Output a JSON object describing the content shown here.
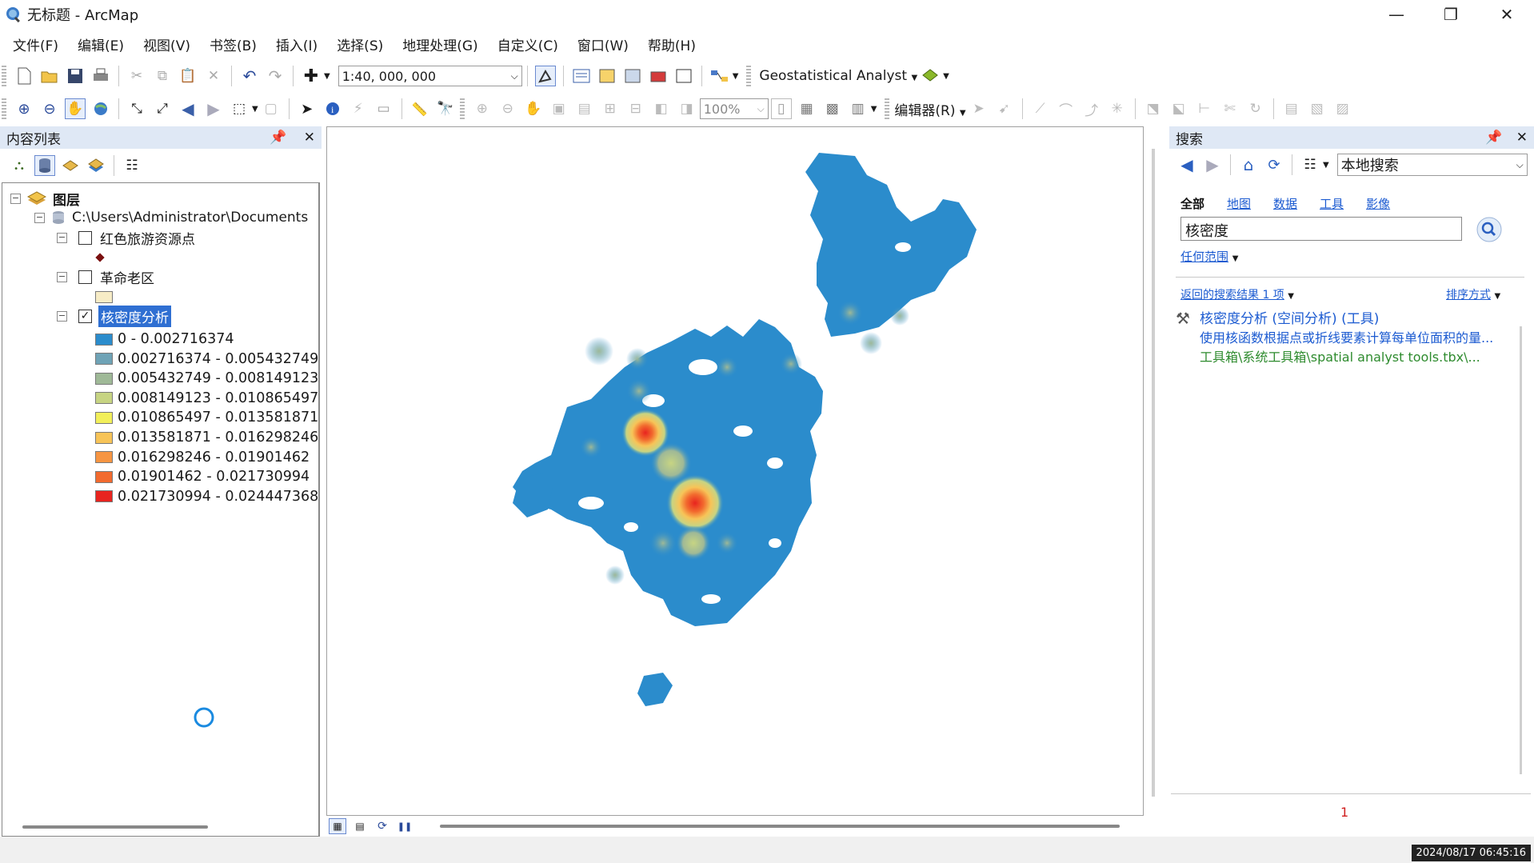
{
  "window": {
    "title": "无标题 - ArcMap"
  },
  "menu": [
    "文件(F)",
    "编辑(E)",
    "视图(V)",
    "书签(B)",
    "插入(I)",
    "选择(S)",
    "地理处理(G)",
    "自定义(C)",
    "窗口(W)",
    "帮助(H)"
  ],
  "toolbar": {
    "scale": "1:40, 000, 000",
    "geostat_label": "Geostatistical Analyst",
    "zoom_percent": "100%",
    "editor_label": "编辑器(R)"
  },
  "toc": {
    "title": "内容列表",
    "root_label": "图层",
    "datasource": "C:\\Users\\Administrator\\Documents",
    "layers": [
      {
        "name": "红色旅游资源点",
        "checked": false
      },
      {
        "name": "革命老区",
        "checked": false
      },
      {
        "name": "核密度分析",
        "checked": true
      }
    ],
    "legend": [
      {
        "label": "0 - 0.002716374",
        "color": "#2b8ccc"
      },
      {
        "label": "0.002716374 - 0.005432749",
        "color": "#6fa3b6"
      },
      {
        "label": "0.005432749 - 0.008149123",
        "color": "#9fb997"
      },
      {
        "label": "0.008149123 - 0.010865497",
        "color": "#c7d483"
      },
      {
        "label": "0.010865497 - 0.013581871",
        "color": "#f2ef5a"
      },
      {
        "label": "0.013581871 - 0.016298246",
        "color": "#f7c458"
      },
      {
        "label": "0.016298246 - 0.01901462",
        "color": "#f79542"
      },
      {
        "label": "0.01901462 - 0.021730994",
        "color": "#f26a2e"
      },
      {
        "label": "0.021730994 - 0.024447368",
        "color": "#e8241f"
      }
    ],
    "point_symbol_color": "#7a1010",
    "polygon_symbol_color": "#f7ecc6"
  },
  "search": {
    "title": "搜索",
    "scope_combo": "本地搜索",
    "tabs": [
      "全部",
      "地图",
      "数据",
      "工具",
      "影像"
    ],
    "query": "核密度",
    "any_extent": "任何范围",
    "results_count": "返回的搜索结果 1 项",
    "sort_label": "排序方式",
    "result": {
      "title": "核密度分析 (空间分析) (工具)",
      "description": "使用核函数根据点或折线要素计算每单位面积的量...",
      "path": "工具箱\\系统工具箱\\spatial analyst tools.tbx\\..."
    },
    "page_number": "1"
  },
  "status": {
    "timestamp": "2024/08/17 06:45:16"
  }
}
